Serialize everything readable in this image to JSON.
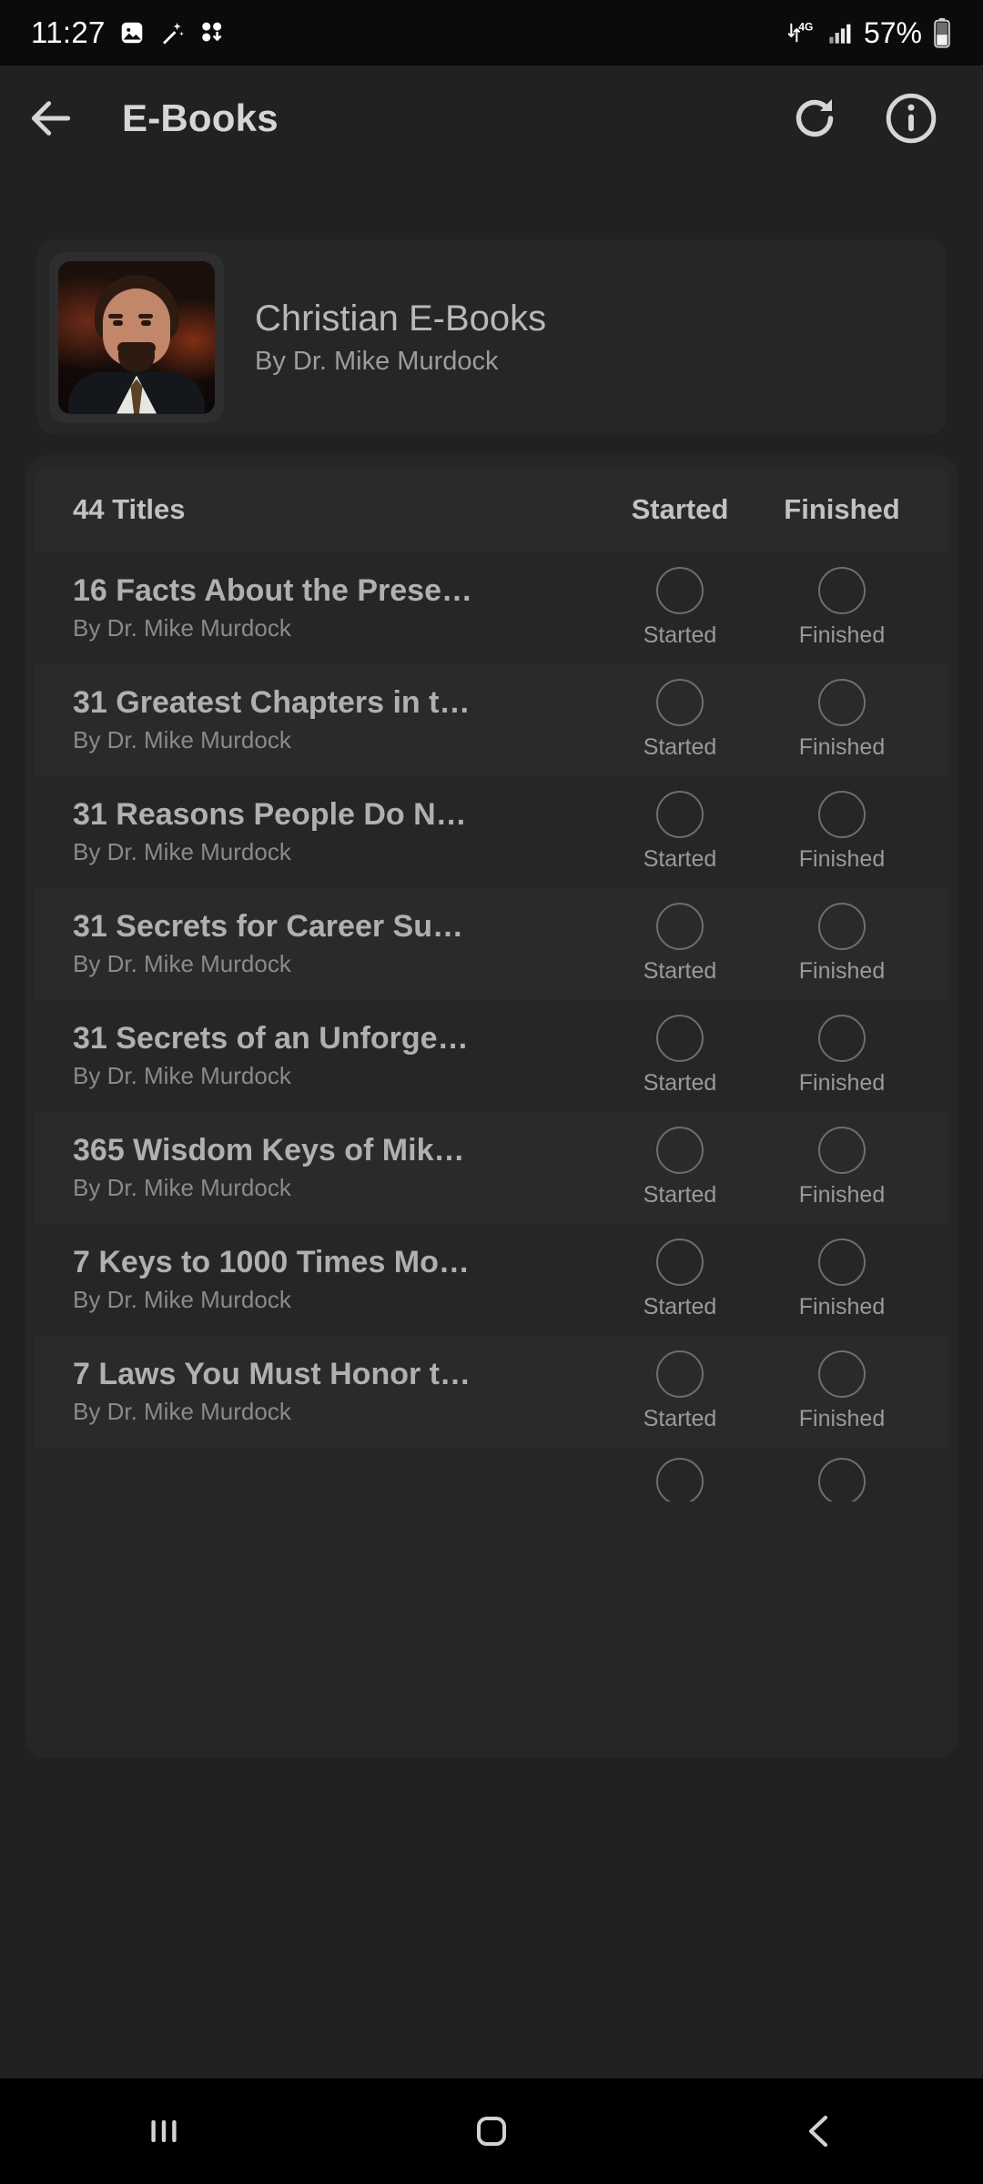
{
  "status_bar": {
    "time": "11:27",
    "left_icons": [
      "image-icon",
      "magic-wand-icon",
      "app-badge-icon"
    ],
    "network_type": "4G",
    "signal_icon": "signal-bars-icon",
    "battery_percent": "57%",
    "battery_icon": "battery-icon"
  },
  "app_bar": {
    "back_icon": "back-arrow-icon",
    "title": "E-Books",
    "refresh_icon": "refresh-icon",
    "info_icon": "info-circle-icon"
  },
  "collection": {
    "title": "Christian E-Books",
    "author": "By Dr. Mike Murdock",
    "cover_icon": "author-portrait-cover"
  },
  "list_header": {
    "count_label": "44 Titles",
    "started_label": "Started",
    "finished_label": "Finished"
  },
  "rows": [
    {
      "title": "16 Facts About the Prese…",
      "author": "By Dr. Mike Murdock",
      "started_label": "Started",
      "finished_label": "Finished",
      "started": false,
      "finished": false
    },
    {
      "title": "31 Greatest Chapters in t…",
      "author": "By Dr. Mike Murdock",
      "started_label": "Started",
      "finished_label": "Finished",
      "started": false,
      "finished": false
    },
    {
      "title": "31 Reasons People Do N…",
      "author": "By Dr. Mike Murdock",
      "started_label": "Started",
      "finished_label": "Finished",
      "started": false,
      "finished": false
    },
    {
      "title": "31 Secrets for Career Su…",
      "author": "By Dr. Mike Murdock",
      "started_label": "Started",
      "finished_label": "Finished",
      "started": false,
      "finished": false
    },
    {
      "title": "31 Secrets of an Unforge…",
      "author": "By Dr. Mike Murdock",
      "started_label": "Started",
      "finished_label": "Finished",
      "started": false,
      "finished": false
    },
    {
      "title": "365 Wisdom Keys of Mik…",
      "author": "By Dr. Mike Murdock",
      "started_label": "Started",
      "finished_label": "Finished",
      "started": false,
      "finished": false
    },
    {
      "title": "7 Keys to 1000 Times Mo…",
      "author": "By Dr. Mike Murdock",
      "started_label": "Started",
      "finished_label": "Finished",
      "started": false,
      "finished": false
    },
    {
      "title": "7 Laws You Must Honor t…",
      "author": "By Dr. Mike Murdock",
      "started_label": "Started",
      "finished_label": "Finished",
      "started": false,
      "finished": false
    }
  ],
  "nav_bar": {
    "recents_icon": "recents-icon",
    "home_icon": "home-icon",
    "back_icon": "nav-back-icon"
  },
  "colors": {
    "background": "#000000",
    "surface": "#212121",
    "card": "#262626",
    "row_alt": "#2a2a2a",
    "text_primary": "#b8b8b8",
    "text_secondary": "#8a8a8a",
    "icon": "#d6d6d6"
  }
}
